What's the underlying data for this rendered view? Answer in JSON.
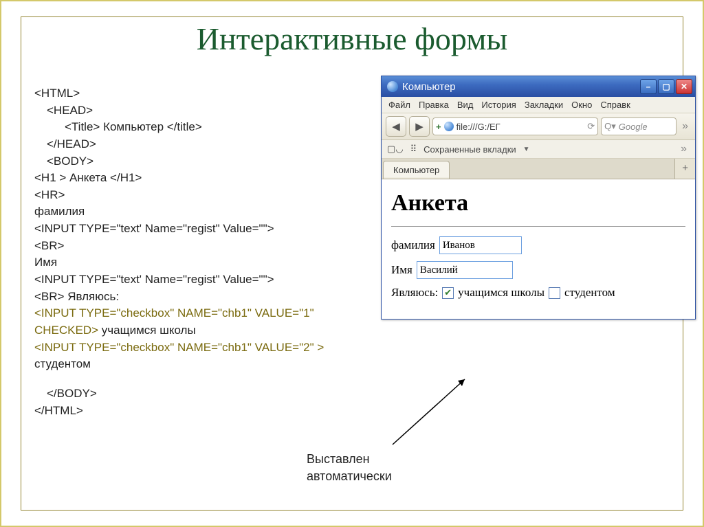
{
  "slide": {
    "title": "Интерактивные формы",
    "caption_line1": "Выставлен",
    "caption_line2": "автоматически"
  },
  "code": {
    "l1": "<HTML>",
    "l2": "<HEAD>",
    "l3": "<Title> Компьютер </title>",
    "l4": "</HEAD>",
    "l5": "<BODY>",
    "l6": "<H1 > Анкета </H1>",
    "l7": "<HR>",
    "l8": "фамилия",
    "l9": "<INPUT TYPE=\"text' Name=\"regist\" Value=\"\">",
    "l10": "<BR>",
    "l11": "Имя",
    "l12": "<INPUT TYPE=\"text' Name=\"regist\" Value=\"\">",
    "l13": "<BR> Являюсь:",
    "l14": "<INPUT TYPE=\"checkbox\" NAME=\"chb1\" VALUE=\"1\" CHECKED>",
    "l14b": "учащимся школы",
    "l15": "<INPUT TYPE=\"checkbox\" NAME=\"chb1\" VALUE=\"2\" >",
    "l15b": "студентом",
    "l16": "</BODY>",
    "l17": "</HTML>"
  },
  "browser": {
    "title": "Компьютер",
    "menu": {
      "file": "Файл",
      "edit": "Правка",
      "view": "Вид",
      "history": "История",
      "bookmarks": "Закладки",
      "window": "Окно",
      "help": "Справк"
    },
    "addr_prefix": "+",
    "addr_url": "file:///G:/ЕГ",
    "search_placeholder": "Google",
    "bookbar_text": "Сохраненные вкладки",
    "tab": "Компьютер"
  },
  "page": {
    "heading": "Анкета",
    "lbl_lastname": "фамилия",
    "val_lastname": "Иванов",
    "lbl_firstname": "Имя",
    "val_firstname": "Василий",
    "lbl_iam": "Являюсь:",
    "chk1_label": "учащимся школы",
    "chk2_label": "студентом"
  }
}
